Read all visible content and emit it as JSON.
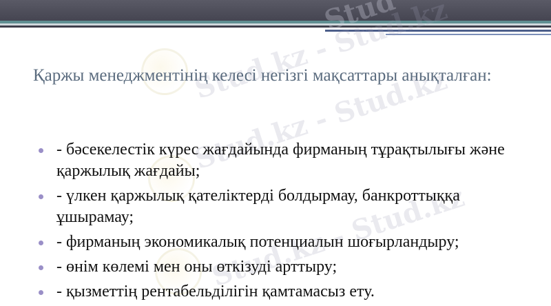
{
  "watermark": {
    "text_top": "Stud",
    "text": "Stud.kz - Stud.kz"
  },
  "slide": {
    "title": "Қаржы менеджментінің келесі негізгі мақсаттары анықталған:",
    "bullets": [
      "- бәсекелестік күрес жағдайында фирманың тұрақтылығы және қаржылық жағдайы;",
      "- үлкен қаржылық қателіктерді болдырмау, банкроттыққа ұшырамау;",
      "- фирманың экономикалық потенциалын шоғырландыру;",
      "- өнім көлемі мен оны өткізуді арттыру;",
      "- қызметтің рентабельділігін қамтамасыз ету."
    ]
  },
  "colors": {
    "header": "#3e3e4a",
    "teal_stripe": "#5f8f92",
    "title_text": "#5a6b7e",
    "bullet_marker": "#9a8fc7"
  }
}
